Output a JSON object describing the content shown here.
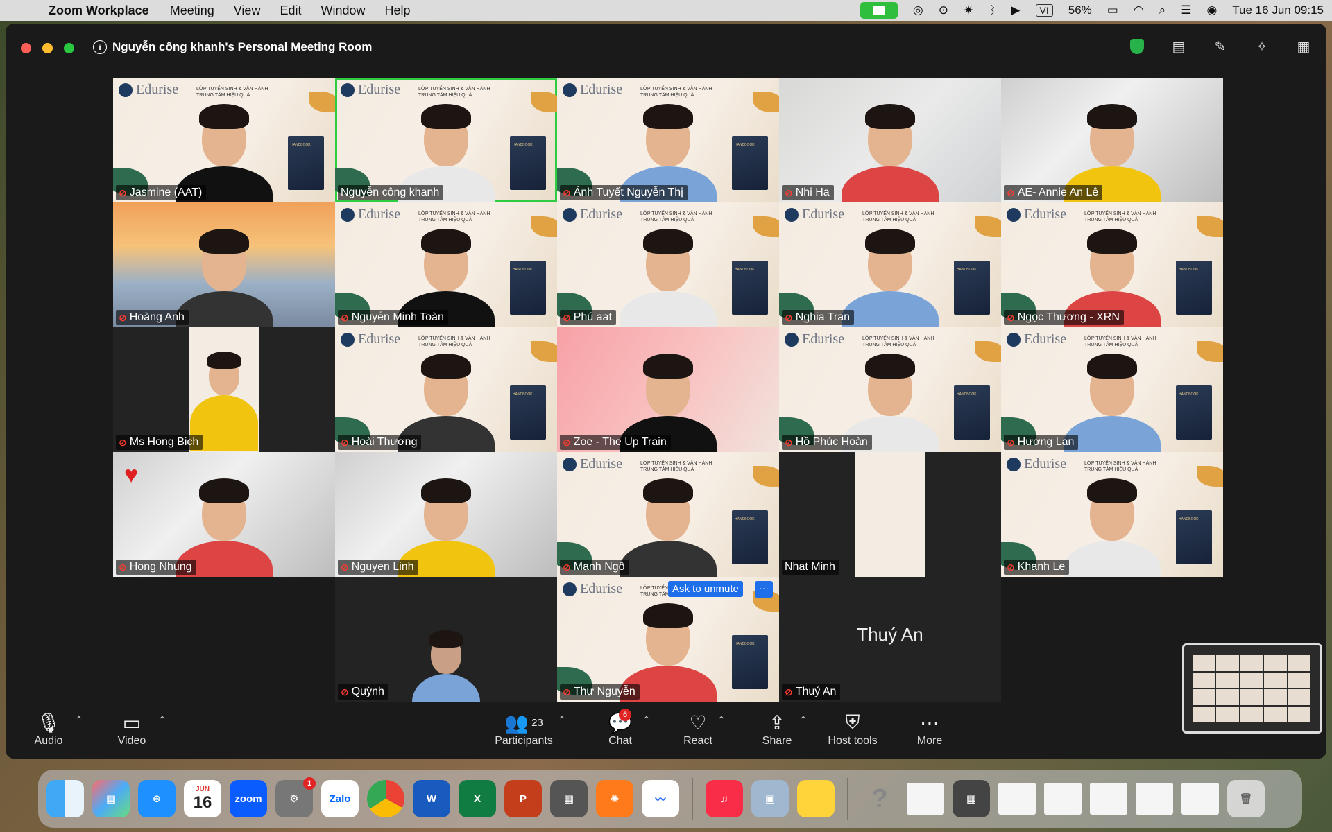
{
  "menubar": {
    "app_name": "Zoom Workplace",
    "menus": [
      "Meeting",
      "View",
      "Edit",
      "Window",
      "Help"
    ],
    "battery": "56%",
    "input_source": "VI",
    "datetime": "Tue 16 Jun  09:15"
  },
  "window": {
    "title": "Nguyễn công khanh's Personal Meeting Room"
  },
  "participants": [
    {
      "name": "Jasmine (AAT)",
      "muted": true
    },
    {
      "name": "Nguyễn công khanh",
      "muted": false
    },
    {
      "name": "Ánh Tuyết Nguyễn Thị",
      "muted": true
    },
    {
      "name": "Nhi Ha",
      "muted": true
    },
    {
      "name": "AE- Annie An Lê",
      "muted": true
    },
    {
      "name": "Hoàng Anh",
      "muted": true
    },
    {
      "name": "Nguyễn Minh Toàn",
      "muted": true
    },
    {
      "name": "Phú aat",
      "muted": true
    },
    {
      "name": "Nghia Tran",
      "muted": true
    },
    {
      "name": "Ngọc Thương - XRN",
      "muted": true
    },
    {
      "name": "Ms Hong Bich",
      "muted": true
    },
    {
      "name": "Hoài Thương",
      "muted": true
    },
    {
      "name": "Zoe - The Up Train",
      "muted": true
    },
    {
      "name": "Hồ Phúc Hoàn",
      "muted": true
    },
    {
      "name": "Hương Lan",
      "muted": true
    },
    {
      "name": "Hong Nhung",
      "muted": true
    },
    {
      "name": "Nguyen Linh",
      "muted": true
    },
    {
      "name": "Mạnh Ngô",
      "muted": true
    },
    {
      "name": "Nhat Minh",
      "muted": false
    },
    {
      "name": "Khanh Le",
      "muted": true
    },
    {
      "name": "Quỳnh",
      "muted": true
    },
    {
      "name": "Thư Nguyễn",
      "muted": true
    },
    {
      "name": "Thuý An",
      "muted": true,
      "center_label": "Thuý An"
    }
  ],
  "brand": {
    "logo_text": "Edurise",
    "slogan_line1": "LỚP TUYỂN SINH & VẬN HÀNH",
    "slogan_line2": "TRUNG TÂM HIỆU QUẢ",
    "book_text": "HANDBOOK"
  },
  "ask_to_unmute": "Ask to unmute",
  "toolbar": {
    "audio": "Audio",
    "video": "Video",
    "participants": "Participants",
    "participants_count": "23",
    "chat": "Chat",
    "chat_badge": "6",
    "react": "React",
    "share": "Share",
    "host_tools": "Host tools",
    "more": "More"
  },
  "dock": {
    "calendar_month": "JUN",
    "calendar_day": "16",
    "zoom_label": "zoom",
    "zalo_label": "Zalo",
    "settings_badge": "1"
  },
  "colors": {
    "speaking_border": "#2ecc40",
    "muted_red": "#ff3b30",
    "accent_blue": "#1f6feb"
  }
}
